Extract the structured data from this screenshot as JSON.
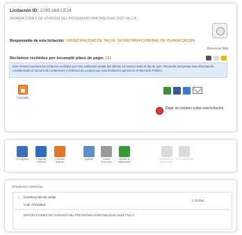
{
  "header": {
    "licitacion_label": "Licitación ID:",
    "licitacion_id": "2295-168-LE24",
    "licitacion_name": "REPARACIONES DE VIVIENDA DEL PROGRAMA HABITABILIDAD 2023 TALCA"
  },
  "responsable": {
    "label": "Responsable de esta licitación:",
    "value": "I MUNICIPALIDAD DE TALCA, SECRETARIA COMUNAL DE PLANIFICACION"
  },
  "denuncias": {
    "label": "Denunciar falta"
  },
  "reclamos": {
    "label": "Reclamos recibidos por incumplir plazo de pago:",
    "count": "111"
  },
  "notice": {
    "text": "Este número muestra los reclamos recibidos por esta institución desde las últimas 12 meses hasta el día de ayer. Recuerde interpretar esta información considerando el número de Licitaciones y Órdenes de compra que esta institución genera en el Mercado Público."
  },
  "estado": {
    "label": "Cerrada"
  },
  "share": {
    "colors": [
      "#3b8f3b",
      "#3b5998",
      "#3b7bd4"
    ]
  },
  "reclamo_action": {
    "label": "Dejar un reclamo sobre esta licitación"
  },
  "toolbar": {
    "items": [
      {
        "label": "Ver adjuntos",
        "color": "#3c6fb5"
      },
      {
        "label": "Preguntas Licitación",
        "color": "#2f6cc0"
      },
      {
        "label": "Consultar licitación",
        "color": "#e0762c"
      },
      {
        "label": "Apertura",
        "color": "#5a8fc7"
      },
      {
        "label": "Cuadro económico",
        "color": "#9a9a9a"
      },
      {
        "label": "Informe de adjudicación",
        "color": "#3a9a3a"
      },
      {
        "label": "Resolución de adjudicación",
        "color": "#999999"
      },
      {
        "label": "Precio adjudicado",
        "color": "#999999"
      }
    ]
  },
  "products": {
    "title": "Productos o servicios",
    "bullet": "1",
    "name": "Construcción de casas",
    "code": "Cod: 72131502",
    "quantity": "1 Global",
    "description": "REPARACIONES DE VIVIENDA DEL PROGRAMA HABITABILIDAD 2023 TALCA"
  }
}
